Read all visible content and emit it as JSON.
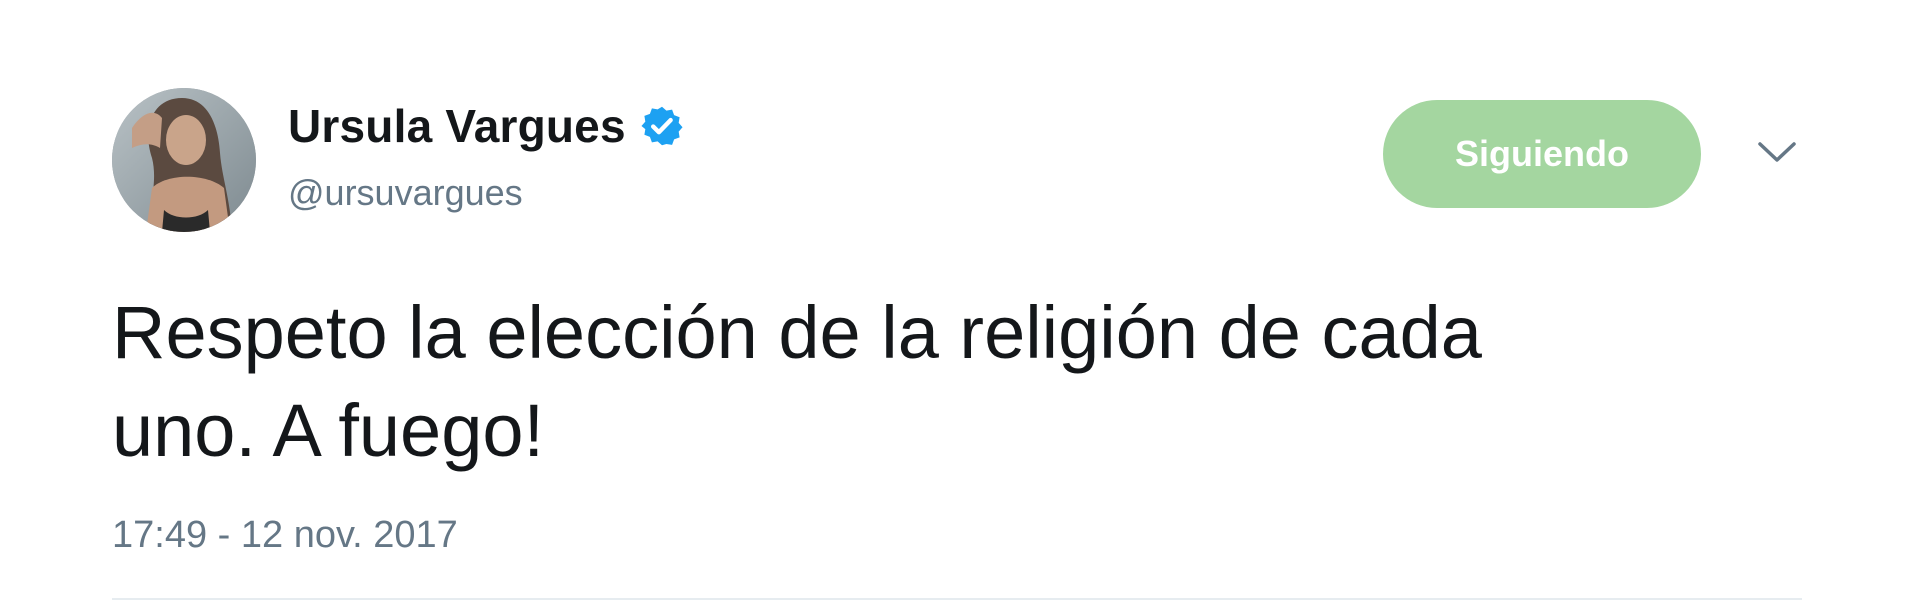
{
  "user": {
    "display_name": "Ursula Vargues",
    "handle": "@ursuvargues",
    "verified": true
  },
  "follow_button": {
    "label": "Siguiendo"
  },
  "tweet": {
    "text": "Respeto la elección de la religión de cada\nuno. A fuego!",
    "timestamp": "17:49 - 12 nov. 2017"
  },
  "icons": {
    "verified": "verified-badge-icon",
    "menu": "chevron-down-icon"
  },
  "colors": {
    "verified_blue": "#1da1f2",
    "follow_button_bg": "#a4d6a0",
    "text_primary": "#14171a",
    "text_secondary": "#657786"
  }
}
